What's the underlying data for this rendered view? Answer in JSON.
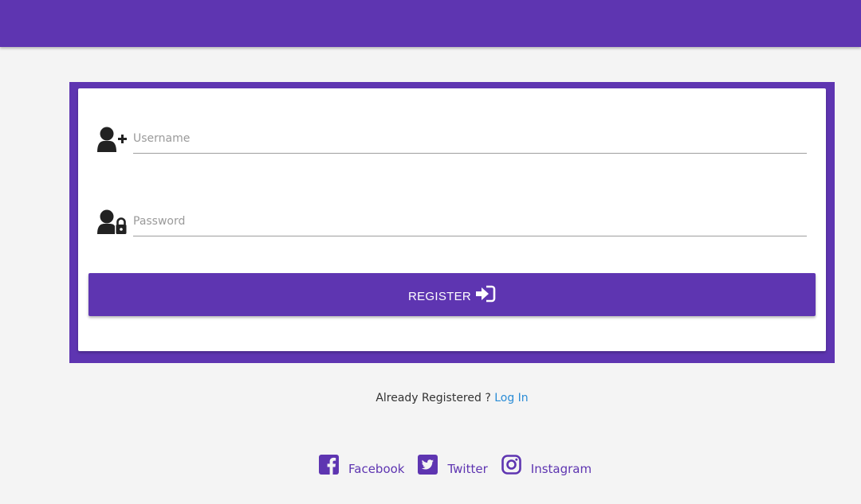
{
  "colors": {
    "primary": "#5e35b1",
    "link": "#2a8cd6",
    "background": "#f4f4f4"
  },
  "form": {
    "username": {
      "placeholder": "Username",
      "value": "",
      "icon": "user-plus-icon"
    },
    "password": {
      "placeholder": "Password",
      "value": "",
      "icon": "user-lock-icon"
    },
    "register_label": "REGISTER",
    "register_icon": "sign-in-icon"
  },
  "footer": {
    "already_text": "Already Registered ?",
    "login_link": "Log In"
  },
  "social": [
    {
      "label": "Facebook",
      "icon": "facebook-square-icon"
    },
    {
      "label": "Twitter",
      "icon": "twitter-square-icon"
    },
    {
      "label": "Instagram",
      "icon": "instagram-icon"
    }
  ]
}
